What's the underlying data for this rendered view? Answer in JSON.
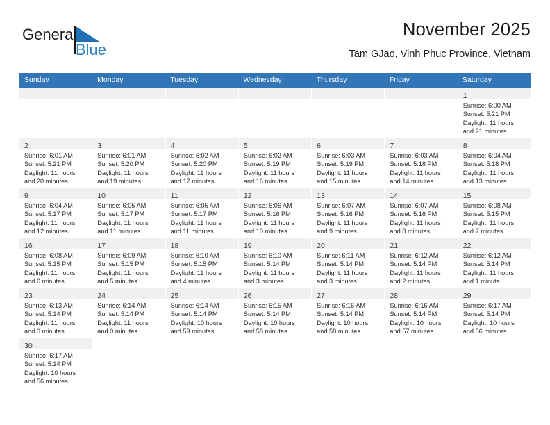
{
  "brand": {
    "name_top": "General",
    "name_bottom": "Blue",
    "top_color": "#1a1a1a",
    "bottom_color": "#2E84C8",
    "triangle_color": "#1E6FB5",
    "logo_icon": "general-blue-logo"
  },
  "header": {
    "title": "November 2025",
    "subtitle": "Tam GJao, Vinh Phuc Province, Vietnam"
  },
  "colors": {
    "header_blue": "#3276B8",
    "row_divider": "#2E6DA8",
    "daynum_band": "#F0F0F0",
    "text": "#2b2b2b"
  },
  "calendar": {
    "weekdays": [
      "Sunday",
      "Monday",
      "Tuesday",
      "Wednesday",
      "Thursday",
      "Friday",
      "Saturday"
    ],
    "weeks": [
      [
        {
          "day": "",
          "blank": true,
          "lines": []
        },
        {
          "day": "",
          "blank": true,
          "lines": []
        },
        {
          "day": "",
          "blank": true,
          "lines": []
        },
        {
          "day": "",
          "blank": true,
          "lines": []
        },
        {
          "day": "",
          "blank": true,
          "lines": []
        },
        {
          "day": "",
          "blank": true,
          "lines": []
        },
        {
          "day": "1",
          "blank": false,
          "lines": [
            "Sunrise: 6:00 AM",
            "Sunset: 5:21 PM",
            "Daylight: 11 hours",
            "and 21 minutes."
          ]
        }
      ],
      [
        {
          "day": "2",
          "blank": false,
          "lines": [
            "Sunrise: 6:01 AM",
            "Sunset: 5:21 PM",
            "Daylight: 11 hours",
            "and 20 minutes."
          ]
        },
        {
          "day": "3",
          "blank": false,
          "lines": [
            "Sunrise: 6:01 AM",
            "Sunset: 5:20 PM",
            "Daylight: 11 hours",
            "and 19 minutes."
          ]
        },
        {
          "day": "4",
          "blank": false,
          "lines": [
            "Sunrise: 6:02 AM",
            "Sunset: 5:20 PM",
            "Daylight: 11 hours",
            "and 17 minutes."
          ]
        },
        {
          "day": "5",
          "blank": false,
          "lines": [
            "Sunrise: 6:02 AM",
            "Sunset: 5:19 PM",
            "Daylight: 11 hours",
            "and 16 minutes."
          ]
        },
        {
          "day": "6",
          "blank": false,
          "lines": [
            "Sunrise: 6:03 AM",
            "Sunset: 5:19 PM",
            "Daylight: 11 hours",
            "and 15 minutes."
          ]
        },
        {
          "day": "7",
          "blank": false,
          "lines": [
            "Sunrise: 6:03 AM",
            "Sunset: 5:18 PM",
            "Daylight: 11 hours",
            "and 14 minutes."
          ]
        },
        {
          "day": "8",
          "blank": false,
          "lines": [
            "Sunrise: 6:04 AM",
            "Sunset: 5:18 PM",
            "Daylight: 11 hours",
            "and 13 minutes."
          ]
        }
      ],
      [
        {
          "day": "9",
          "blank": false,
          "lines": [
            "Sunrise: 6:04 AM",
            "Sunset: 5:17 PM",
            "Daylight: 11 hours",
            "and 12 minutes."
          ]
        },
        {
          "day": "10",
          "blank": false,
          "lines": [
            "Sunrise: 6:05 AM",
            "Sunset: 5:17 PM",
            "Daylight: 11 hours",
            "and 11 minutes."
          ]
        },
        {
          "day": "11",
          "blank": false,
          "lines": [
            "Sunrise: 6:05 AM",
            "Sunset: 5:17 PM",
            "Daylight: 11 hours",
            "and 11 minutes."
          ]
        },
        {
          "day": "12",
          "blank": false,
          "lines": [
            "Sunrise: 6:06 AM",
            "Sunset: 5:16 PM",
            "Daylight: 11 hours",
            "and 10 minutes."
          ]
        },
        {
          "day": "13",
          "blank": false,
          "lines": [
            "Sunrise: 6:07 AM",
            "Sunset: 5:16 PM",
            "Daylight: 11 hours",
            "and 9 minutes."
          ]
        },
        {
          "day": "14",
          "blank": false,
          "lines": [
            "Sunrise: 6:07 AM",
            "Sunset: 5:16 PM",
            "Daylight: 11 hours",
            "and 8 minutes."
          ]
        },
        {
          "day": "15",
          "blank": false,
          "lines": [
            "Sunrise: 6:08 AM",
            "Sunset: 5:15 PM",
            "Daylight: 11 hours",
            "and 7 minutes."
          ]
        }
      ],
      [
        {
          "day": "16",
          "blank": false,
          "lines": [
            "Sunrise: 6:08 AM",
            "Sunset: 5:15 PM",
            "Daylight: 11 hours",
            "and 6 minutes."
          ]
        },
        {
          "day": "17",
          "blank": false,
          "lines": [
            "Sunrise: 6:09 AM",
            "Sunset: 5:15 PM",
            "Daylight: 11 hours",
            "and 5 minutes."
          ]
        },
        {
          "day": "18",
          "blank": false,
          "lines": [
            "Sunrise: 6:10 AM",
            "Sunset: 5:15 PM",
            "Daylight: 11 hours",
            "and 4 minutes."
          ]
        },
        {
          "day": "19",
          "blank": false,
          "lines": [
            "Sunrise: 6:10 AM",
            "Sunset: 5:14 PM",
            "Daylight: 11 hours",
            "and 3 minutes."
          ]
        },
        {
          "day": "20",
          "blank": false,
          "lines": [
            "Sunrise: 6:11 AM",
            "Sunset: 5:14 PM",
            "Daylight: 11 hours",
            "and 3 minutes."
          ]
        },
        {
          "day": "21",
          "blank": false,
          "lines": [
            "Sunrise: 6:12 AM",
            "Sunset: 5:14 PM",
            "Daylight: 11 hours",
            "and 2 minutes."
          ]
        },
        {
          "day": "22",
          "blank": false,
          "lines": [
            "Sunrise: 6:12 AM",
            "Sunset: 5:14 PM",
            "Daylight: 11 hours",
            "and 1 minute."
          ]
        }
      ],
      [
        {
          "day": "23",
          "blank": false,
          "lines": [
            "Sunrise: 6:13 AM",
            "Sunset: 5:14 PM",
            "Daylight: 11 hours",
            "and 0 minutes."
          ]
        },
        {
          "day": "24",
          "blank": false,
          "lines": [
            "Sunrise: 6:14 AM",
            "Sunset: 5:14 PM",
            "Daylight: 11 hours",
            "and 0 minutes."
          ]
        },
        {
          "day": "25",
          "blank": false,
          "lines": [
            "Sunrise: 6:14 AM",
            "Sunset: 5:14 PM",
            "Daylight: 10 hours",
            "and 59 minutes."
          ]
        },
        {
          "day": "26",
          "blank": false,
          "lines": [
            "Sunrise: 6:15 AM",
            "Sunset: 5:14 PM",
            "Daylight: 10 hours",
            "and 58 minutes."
          ]
        },
        {
          "day": "27",
          "blank": false,
          "lines": [
            "Sunrise: 6:16 AM",
            "Sunset: 5:14 PM",
            "Daylight: 10 hours",
            "and 58 minutes."
          ]
        },
        {
          "day": "28",
          "blank": false,
          "lines": [
            "Sunrise: 6:16 AM",
            "Sunset: 5:14 PM",
            "Daylight: 10 hours",
            "and 57 minutes."
          ]
        },
        {
          "day": "29",
          "blank": false,
          "lines": [
            "Sunrise: 6:17 AM",
            "Sunset: 5:14 PM",
            "Daylight: 10 hours",
            "and 56 minutes."
          ]
        }
      ],
      [
        {
          "day": "30",
          "blank": false,
          "lines": [
            "Sunrise: 6:17 AM",
            "Sunset: 5:14 PM",
            "Daylight: 10 hours",
            "and 56 minutes."
          ]
        },
        {
          "day": "",
          "blank": true,
          "lines": []
        },
        {
          "day": "",
          "blank": true,
          "lines": []
        },
        {
          "day": "",
          "blank": true,
          "lines": []
        },
        {
          "day": "",
          "blank": true,
          "lines": []
        },
        {
          "day": "",
          "blank": true,
          "lines": []
        },
        {
          "day": "",
          "blank": true,
          "lines": []
        }
      ]
    ]
  }
}
